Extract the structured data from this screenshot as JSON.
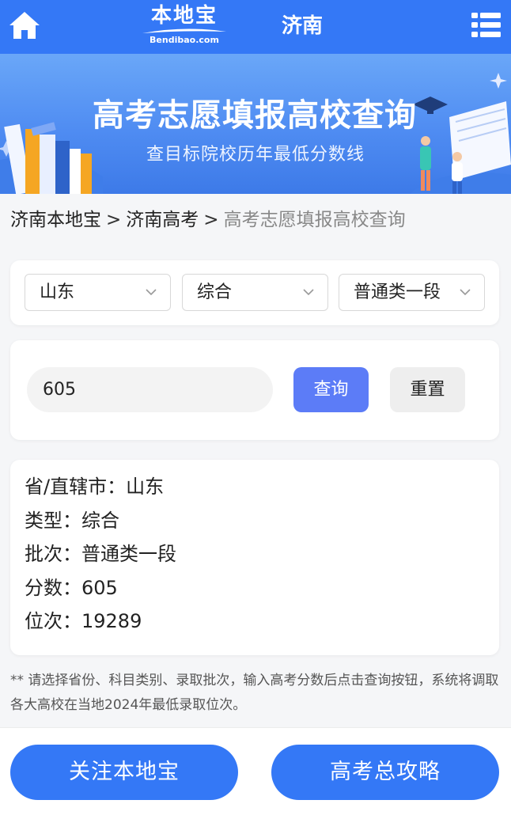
{
  "header": {
    "logo_cn": "本地宝",
    "logo_en": "Bendibao.com",
    "city": "济南"
  },
  "banner": {
    "title": "高考志愿填报高校查询",
    "subtitle": "查目标院校历年最低分数线"
  },
  "breadcrumb": {
    "items": [
      "济南本地宝",
      "济南高考"
    ],
    "current": "高考志愿填报高校查询",
    "separator": ">"
  },
  "filters": {
    "province": "山东",
    "type": "综合",
    "batch": "普通类一段"
  },
  "search": {
    "score_value": "605",
    "query_label": "查询",
    "reset_label": "重置"
  },
  "result": {
    "province": "省/直辖市：山东",
    "type": "类型：综合",
    "batch": "批次：普通类一段",
    "score": "分数：605",
    "rank": "位次：19289"
  },
  "note": "** 请选择省份、科目类别、录取批次，输入高考分数后点击查询按钮，系统将调取各大高校在当地2024年最低录取位次。",
  "bottom": {
    "follow_label": "关注本地宝",
    "guide_label": "高考总攻略"
  },
  "colors": {
    "brand": "#3478f6",
    "query_button": "#5c7cf7"
  }
}
